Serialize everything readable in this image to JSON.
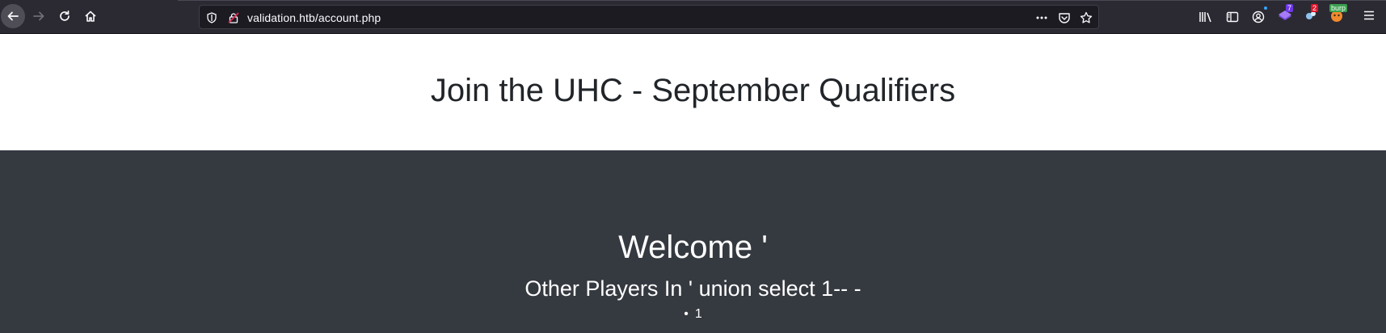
{
  "browser": {
    "url": "validation.htb/account.php",
    "icons": [
      "back-arrow-icon",
      "forward-arrow-icon",
      "reload-icon",
      "home-icon",
      "tracking-shield-icon",
      "insecure-lock-icon",
      "more-actions-icon",
      "pocket-icon",
      "bookmark-star-icon",
      "library-icon",
      "sidebar-icon",
      "account-icon",
      "extension-icon",
      "extension-icon",
      "burp-icon",
      "menu-icon"
    ],
    "extension_badges": [
      "7",
      "2",
      "burp"
    ],
    "colors": {
      "toolbar": "#2b2a33",
      "urlbar": "#1c1b22",
      "badge_purple": "#6e37e6",
      "badge_red": "#e0152b",
      "badge_green": "#3aa04f"
    }
  },
  "page": {
    "header_title": "Join the UHC - September Qualifiers",
    "welcome": "Welcome '",
    "players_heading": "Other Players In ' union select 1-- -",
    "players": [
      "1"
    ],
    "colors": {
      "header_bg": "#ffffff",
      "main_bg": "#353940",
      "text_dark": "#212529",
      "text_light": "#ffffff"
    }
  }
}
